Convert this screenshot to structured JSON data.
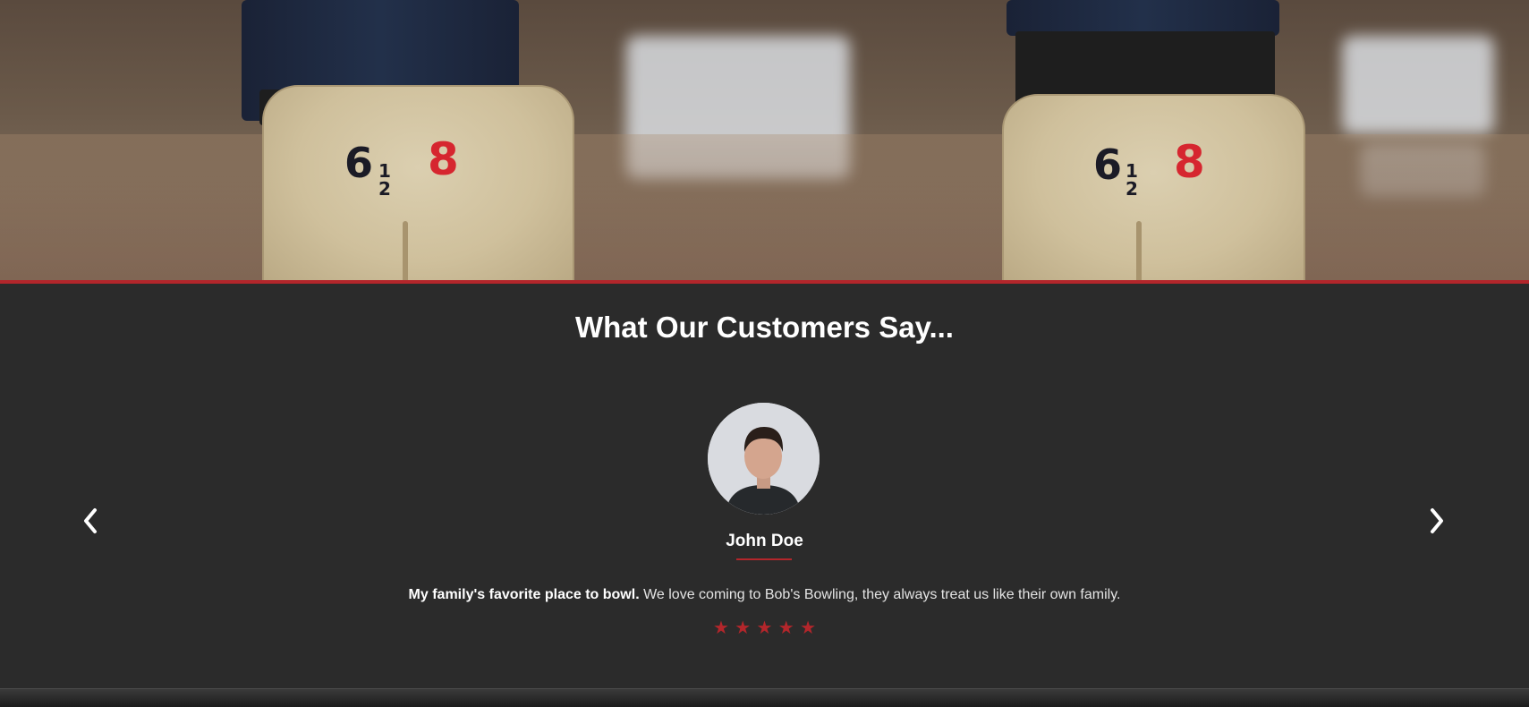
{
  "hero": {
    "shoe_size_whole": "6",
    "shoe_size_fraction_num": "1",
    "shoe_size_fraction_den": "2",
    "shoe_size_alt": "8"
  },
  "testimonials": {
    "title": "What Our Customers Say...",
    "items": [
      {
        "name": "John Doe",
        "quote_bold": "My family's favorite place to bowl.",
        "quote_text": " We love coming to Bob's Bowling, they always treat us like their own family.",
        "rating": 5
      }
    ],
    "prev_icon": "chevron-left-icon",
    "next_icon": "chevron-right-icon"
  },
  "colors": {
    "accent": "#b3262b",
    "background": "#2b2b2b",
    "text": "#ffffff"
  }
}
